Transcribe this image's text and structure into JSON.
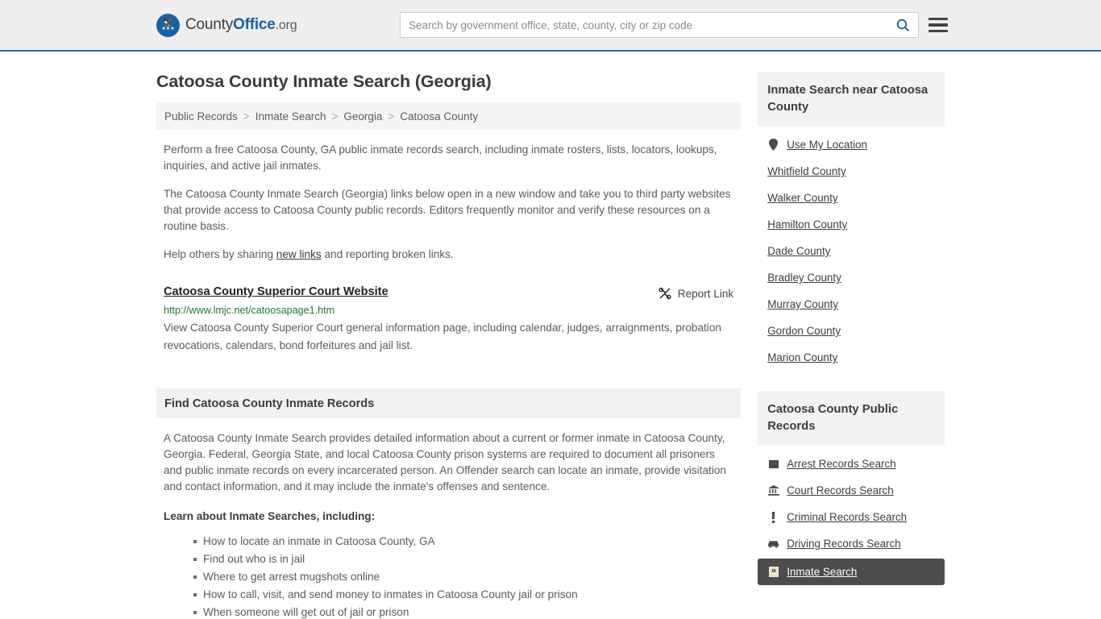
{
  "header": {
    "logo": {
      "prefix": "County",
      "bold": "Office",
      "suffix": ".org",
      "icon": "eagle-shield-icon"
    },
    "search": {
      "placeholder": "Search by government office, state, county, city or zip code",
      "value": "",
      "icon": "search-icon"
    },
    "menu_icon": "hamburger-menu-icon",
    "accent_color": "#2e6ca4"
  },
  "main": {
    "title": "Catoosa County Inmate Search (Georgia)",
    "breadcrumb": [
      {
        "label": "Public Records"
      },
      {
        "label": "Inmate Search"
      },
      {
        "label": "Georgia"
      },
      {
        "label": "Catoosa County"
      }
    ],
    "breadcrumb_separator": ">",
    "paragraphs": {
      "p1": "Perform a free Catoosa County, GA public inmate records search, including inmate rosters, lists, locators, lookups, inquiries, and active jail inmates.",
      "p2": "The Catoosa County Inmate Search (Georgia) links below open in a new window and take you to third party websites that provide access to Catoosa County public records. Editors frequently monitor and verify these resources on a routine basis.",
      "p3_before": "Help others by sharing ",
      "p3_link": "new links",
      "p3_after": " and reporting broken links."
    },
    "link_entry": {
      "title": "Catoosa County Superior Court Website",
      "url": "http://www.lmjc.net/catoosapage1.htm",
      "description": "View Catoosa County Superior Court general information page, including calendar, judges, arraignments, probation revocations, calendars, bond forfeitures and jail list.",
      "report_label": "Report Link",
      "report_icon": "broken-link-icon",
      "url_color": "#1a7a30"
    },
    "section": {
      "heading": "Find Catoosa County Inmate Records",
      "body": "A Catoosa County Inmate Search provides detailed information about a current or former inmate in Catoosa County, Georgia. Federal, Georgia State, and local Catoosa County prison systems are required to document all prisoners and public inmate records on every incarcerated person. An Offender search can locate an inmate, provide visitation and contact information, and it may include the inmate's offenses and sentence.",
      "lead_in": "Learn about Inmate Searches, including:",
      "bullets": [
        "How to locate an inmate in Catoosa County, GA",
        "Find out who is in jail",
        "Where to get arrest mugshots online",
        "How to call, visit, and send money to inmates in Catoosa County jail or prison",
        "When someone will get out of jail or prison"
      ]
    }
  },
  "sidebar": {
    "nearby": {
      "heading": "Inmate Search near Catoosa County",
      "items": [
        {
          "label": "Use My Location",
          "icon": "map-pin-icon"
        },
        {
          "label": "Whitfield County",
          "icon": ""
        },
        {
          "label": "Walker County",
          "icon": ""
        },
        {
          "label": "Hamilton County",
          "icon": ""
        },
        {
          "label": "Dade County",
          "icon": ""
        },
        {
          "label": "Bradley County",
          "icon": ""
        },
        {
          "label": "Murray County",
          "icon": ""
        },
        {
          "label": "Gordon County",
          "icon": ""
        },
        {
          "label": "Marion County",
          "icon": ""
        }
      ]
    },
    "public_records": {
      "heading": "Catoosa County Public Records",
      "items": [
        {
          "label": "Arrest Records Search",
          "icon": "square-icon",
          "active": false
        },
        {
          "label": "Court Records Search",
          "icon": "courthouse-icon",
          "active": false
        },
        {
          "label": "Criminal Records Search",
          "icon": "exclamation-icon",
          "active": false
        },
        {
          "label": "Driving Records Search",
          "icon": "car-icon",
          "active": false
        },
        {
          "label": "Inmate Search",
          "icon": "jail-door-icon",
          "active": true
        }
      ],
      "active_background": "#4c4c4c"
    }
  }
}
